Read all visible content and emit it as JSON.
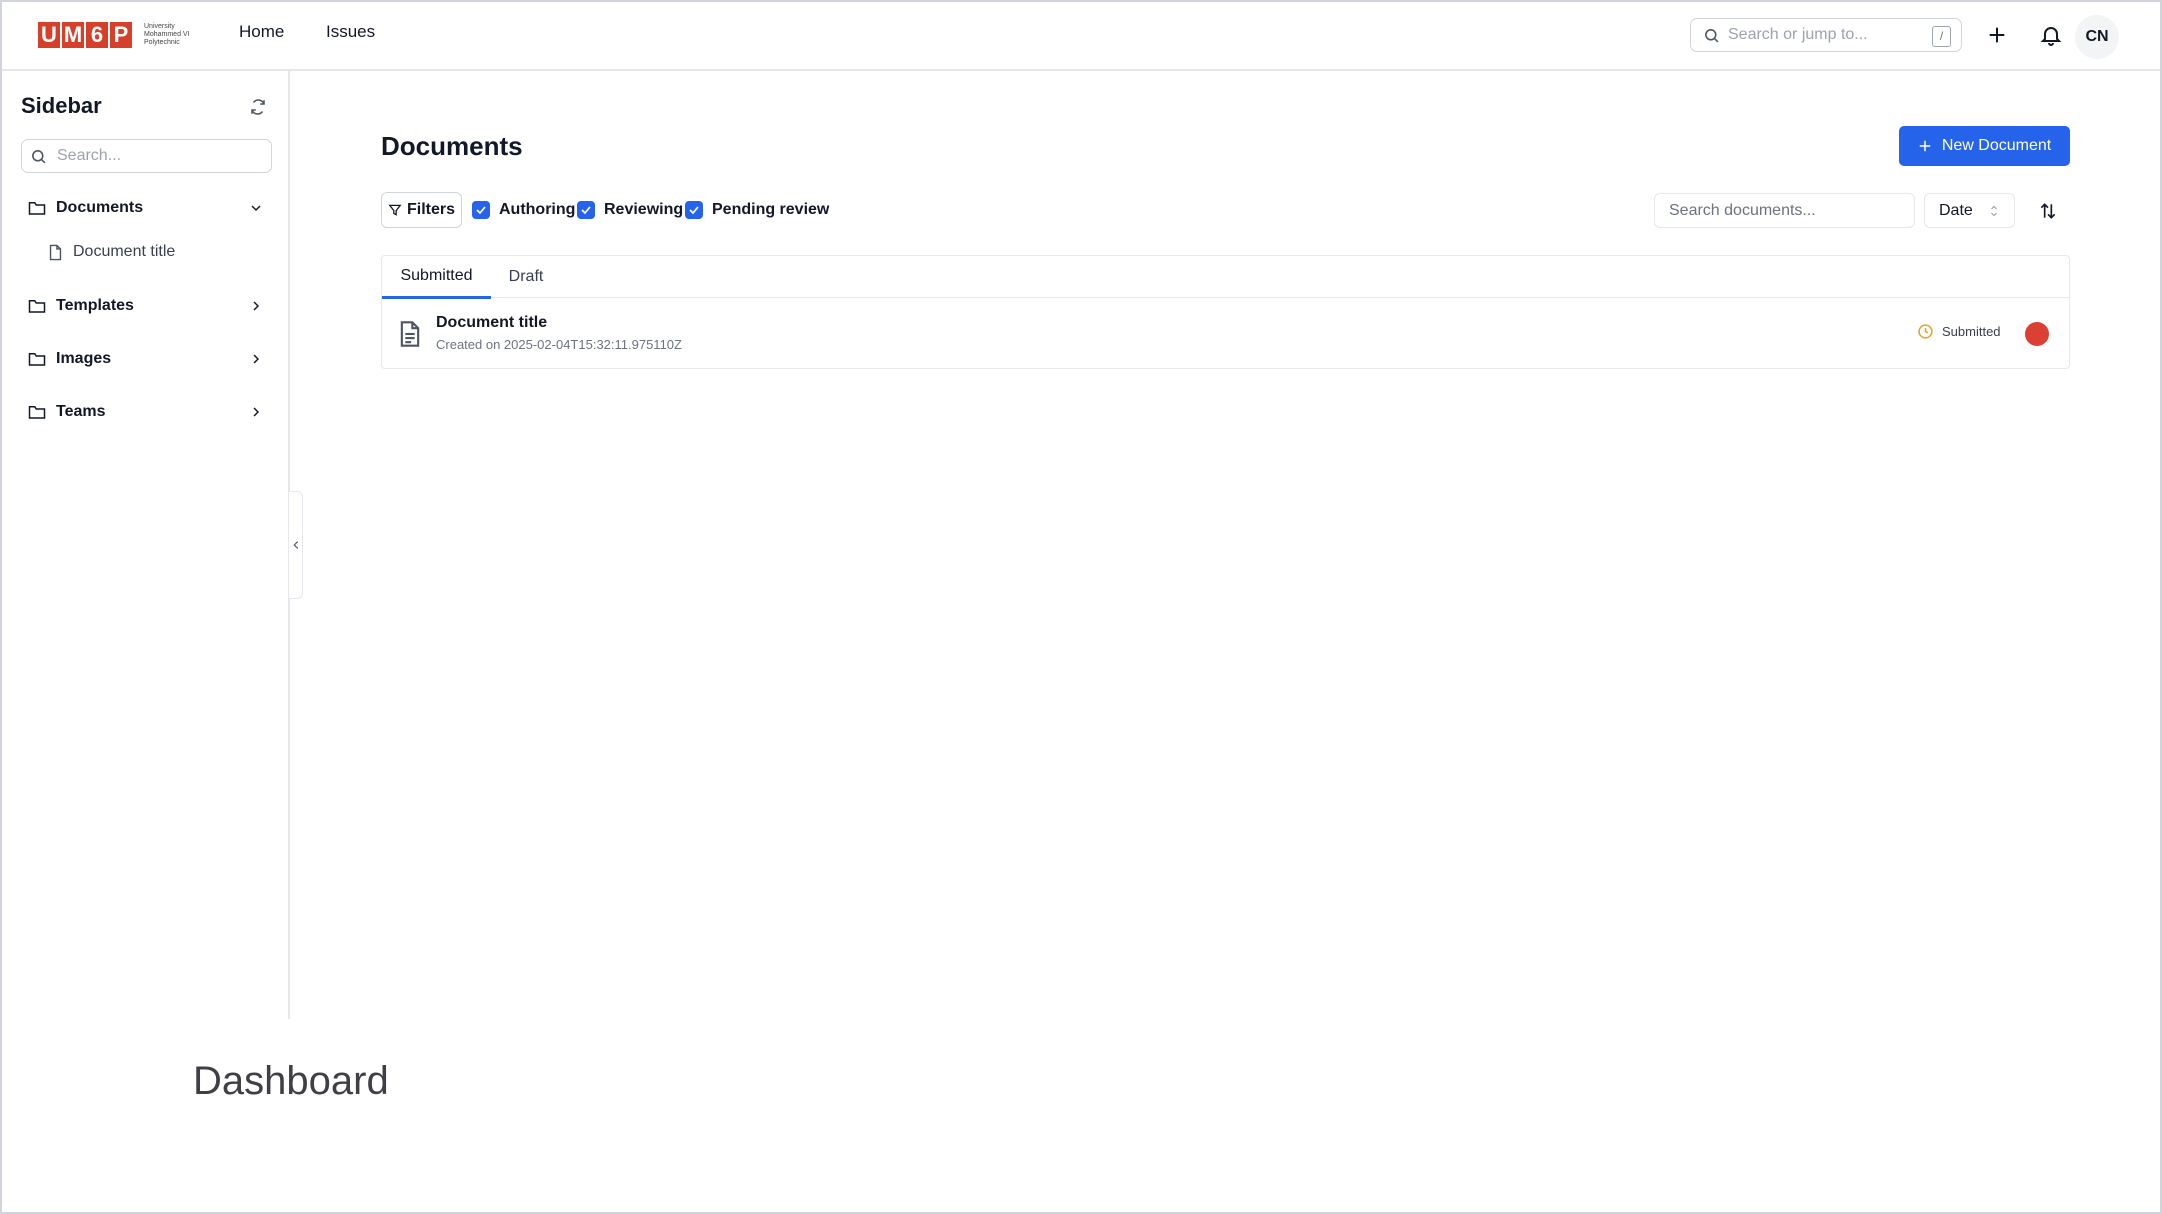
{
  "brand": {
    "tiles": [
      "U",
      "M",
      "6",
      "P"
    ],
    "line1": "University",
    "line2": "Mohammed VI",
    "line3": "Polytechnic",
    "accent": "#d6402a"
  },
  "nav": {
    "home": "Home",
    "issues": "Issues"
  },
  "global_search": {
    "placeholder": "Search or jump to...",
    "shortcut": "/"
  },
  "header_icons": {
    "add": "plus-icon",
    "notifications": "bell-icon"
  },
  "user": {
    "initials": "CN"
  },
  "sidebar": {
    "title": "Sidebar",
    "search_placeholder": "Search...",
    "items": [
      {
        "label": "Documents",
        "expanded": true,
        "children": [
          "Document title"
        ]
      },
      {
        "label": "Templates",
        "expanded": false
      },
      {
        "label": "Images",
        "expanded": false
      },
      {
        "label": "Teams",
        "expanded": false
      }
    ]
  },
  "main": {
    "title": "Documents",
    "new_button": "New Document",
    "filters_label": "Filters",
    "checks": [
      "Authoring",
      "Reviewing",
      "Pending review"
    ],
    "search_placeholder": "Search documents...",
    "sort_by": "Date",
    "tabs": [
      "Submitted",
      "Draft"
    ],
    "active_tab": "Submitted",
    "rows": [
      {
        "title": "Document title",
        "subtitle": "Created on 2025-02-04T15:32:11.975110Z",
        "status": "Submitted",
        "status_color": "#e0a526",
        "dot_color": "#dc3f34"
      }
    ]
  },
  "colors": {
    "primary": "#2563eb"
  },
  "caption": "Dashboard"
}
